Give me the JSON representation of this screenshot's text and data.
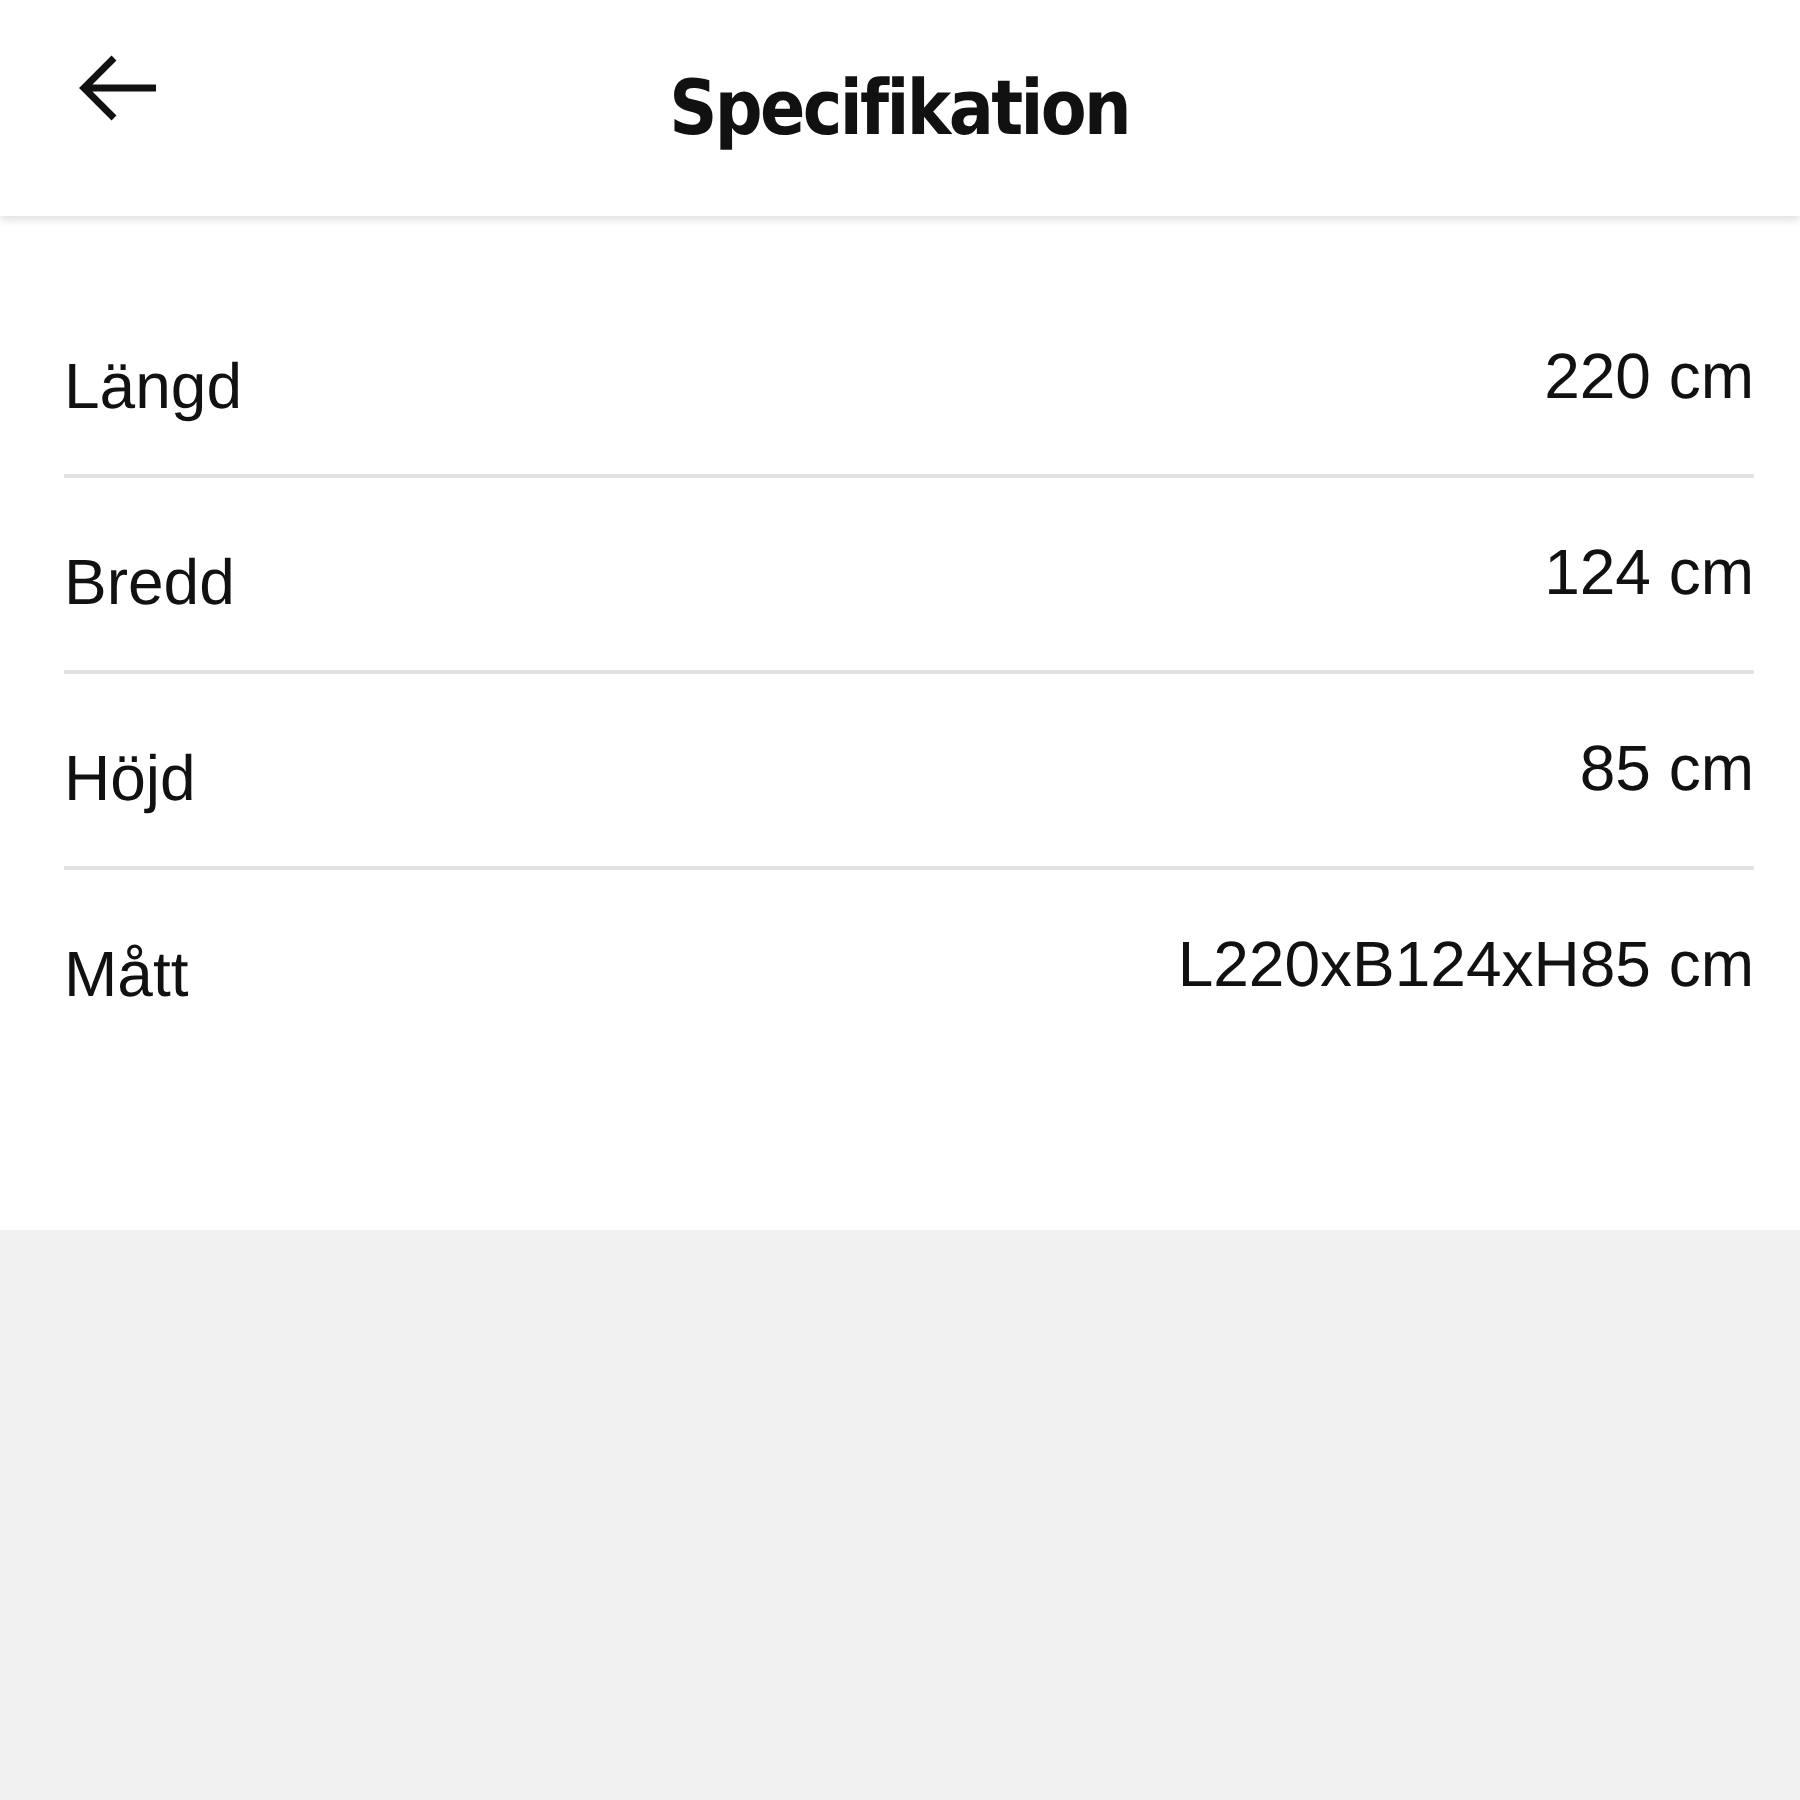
{
  "header": {
    "title": "Specifikation"
  },
  "specs": [
    {
      "label": "Längd",
      "value": "220 cm"
    },
    {
      "label": "Bredd",
      "value": "124 cm"
    },
    {
      "label": "Höjd",
      "value": "85 cm"
    },
    {
      "label": "Mått",
      "value": "L220xB124xH85 cm"
    }
  ]
}
